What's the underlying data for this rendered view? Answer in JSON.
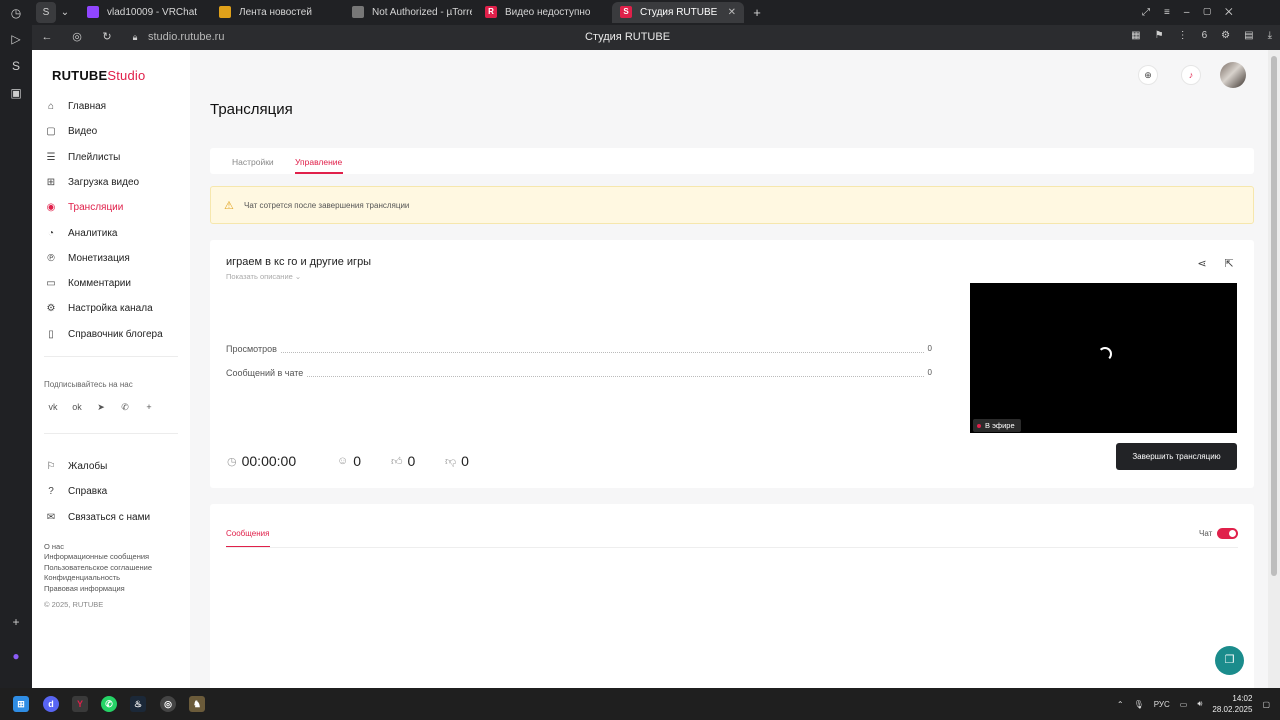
{
  "browser": {
    "tabs": [
      {
        "label": "vlad10009 - VRChat",
        "icon": "twitch-icon",
        "color": "#9146ff"
      },
      {
        "label": "Лента новостей",
        "icon": "news-icon",
        "color": "#e0a11a"
      },
      {
        "label": "Not Authorized - µTorrent",
        "icon": "doc-icon",
        "color": "#777777"
      },
      {
        "label": "Видео недоступно",
        "icon": "rutube-r-icon",
        "color": "#e0204a"
      },
      {
        "label": "Студия RUTUBE",
        "icon": "rutube-studio-icon",
        "color": "#e0204a",
        "active": true
      }
    ],
    "tab_close": "✕",
    "new_tab": "+",
    "url": "studio.rutube.ru",
    "page_title": "Студия RUTUBE"
  },
  "sidebar": {
    "logo_main": "RUTUBE",
    "logo_sub": "Studio",
    "items": [
      {
        "label": "Главная",
        "icon": "home-icon"
      },
      {
        "label": "Видео",
        "icon": "video-icon"
      },
      {
        "label": "Плейлисты",
        "icon": "playlist-icon"
      },
      {
        "label": "Загрузка видео",
        "icon": "upload-icon"
      },
      {
        "label": "Трансляции",
        "icon": "broadcast-icon",
        "active": true
      },
      {
        "label": "Аналитика",
        "icon": "analytics-icon"
      },
      {
        "label": "Монетизация",
        "icon": "money-icon"
      },
      {
        "label": "Комментарии",
        "icon": "comments-icon"
      },
      {
        "label": "Настройка канала",
        "icon": "gear-icon"
      },
      {
        "label": "Справочник блогера",
        "icon": "book-icon"
      }
    ],
    "subscribe_label": "Подписывайтесь на нас",
    "socials": [
      "vk-icon",
      "ok-icon",
      "telegram-icon",
      "viber-icon",
      "plus-icon"
    ],
    "bottom_items": [
      {
        "label": "Жалобы",
        "icon": "flag-icon"
      },
      {
        "label": "Справка",
        "icon": "help-icon"
      },
      {
        "label": "Связаться с нами",
        "icon": "mail-icon"
      }
    ],
    "footer_links": [
      "О нас",
      "Информационные сообщения",
      "Пользовательское соглашение",
      "Конфиденциальность",
      "Правовая информация"
    ],
    "copyright": "© 2025, RUTUBE"
  },
  "main": {
    "page_title": "Трансляция",
    "tabs": [
      {
        "label": "Настройки"
      },
      {
        "label": "Управление",
        "active": true
      }
    ],
    "warning": "Чат сотрется после завершения трансляции",
    "stream": {
      "title": "играем в кс го и другие игры",
      "show_description": "Показать описание ⌄",
      "stats": [
        {
          "label": "Просмотров",
          "value": "0"
        },
        {
          "label": "Сообщений в чате",
          "value": "0"
        }
      ],
      "live_badge": "В эфире",
      "duration": "00:00:00",
      "viewers": "0",
      "likes": "0",
      "dislikes": "0",
      "end_button": "Завершить трансляцию"
    },
    "chat": {
      "tab": "Сообщения",
      "toggle_label": "Чат",
      "toggle_on": true
    }
  },
  "taskbar": {
    "lang": "РУС",
    "time": "14:02",
    "date": "28.02.2025"
  },
  "colors": {
    "accent": "#e0204a",
    "warning_bg": "#fff8e1",
    "support": "#1b8c8c"
  }
}
